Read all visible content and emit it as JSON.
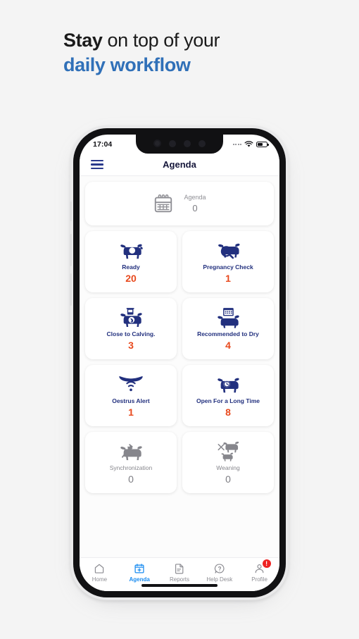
{
  "headline": {
    "line1_bold": "Stay",
    "line1_rest": " on top of your",
    "line2": "daily workflow",
    "accent_color": "#3070b8"
  },
  "phone": {
    "statusbar": {
      "time": "17:04",
      "wifi_icon": "wifi-icon",
      "battery_icon": "battery-icon",
      "signal_icon": "signal-dots-icon"
    },
    "header": {
      "menu_icon": "hamburger-menu-icon",
      "title": "Agenda"
    },
    "agenda_summary": {
      "icon": "calendar-icon",
      "label": "Agenda",
      "value": "0"
    },
    "tiles": [
      {
        "label": "Ready",
        "value": "20",
        "icon": "cow-icon",
        "muted": false
      },
      {
        "label": "Pregnancy Check",
        "value": "1",
        "icon": "cow-magnifier-icon",
        "muted": false
      },
      {
        "label": "Close to Calving.",
        "value": "3",
        "icon": "cow-calving-icon",
        "muted": false
      },
      {
        "label": "Recommended to Dry",
        "value": "4",
        "icon": "cow-calendar-icon",
        "muted": false
      },
      {
        "label": "Oestrus Alert",
        "value": "1",
        "icon": "horns-signal-icon",
        "muted": false
      },
      {
        "label": "Open For a Long Time",
        "value": "8",
        "icon": "cow-clock-icon",
        "muted": false
      },
      {
        "label": "Synchronization",
        "value": "0",
        "icon": "cow-syringe-icon",
        "muted": true
      },
      {
        "label": "Weaning",
        "value": "0",
        "icon": "cow-calf-icon",
        "muted": true
      }
    ],
    "tabs": [
      {
        "label": "Home",
        "icon": "home-icon",
        "active": false,
        "badge": ""
      },
      {
        "label": "Agenda",
        "icon": "calendar-plus-icon",
        "active": true,
        "badge": ""
      },
      {
        "label": "Reports",
        "icon": "document-icon",
        "active": false,
        "badge": ""
      },
      {
        "label": "Help Desk",
        "icon": "question-bubble-icon",
        "active": false,
        "badge": ""
      },
      {
        "label": "Profile",
        "icon": "person-icon",
        "active": false,
        "badge": "!"
      }
    ]
  },
  "colors": {
    "navy": "#22307e",
    "orange": "#e8491d",
    "tab_active": "#1a8cf0",
    "muted": "#86868c",
    "badge_red": "#ee2222"
  }
}
